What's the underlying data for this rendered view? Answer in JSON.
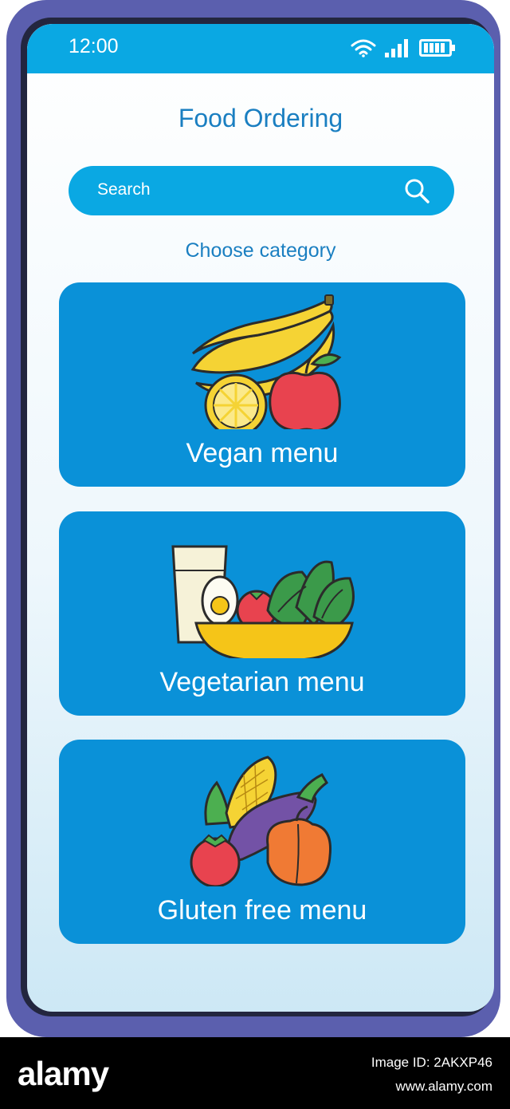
{
  "status_bar": {
    "time": "12:00",
    "icons": [
      "wifi-icon",
      "signal-icon",
      "battery-icon"
    ]
  },
  "app": {
    "title": "Food Ordering"
  },
  "search": {
    "placeholder": "Search",
    "icon": "search-icon"
  },
  "category_section": {
    "heading": "Choose category",
    "items": [
      {
        "label": "Vegan menu",
        "icon": "fruit-icon"
      },
      {
        "label": "Vegetarian menu",
        "icon": "salad-icon"
      },
      {
        "label": "Gluten free menu",
        "icon": "vegetables-icon"
      }
    ]
  },
  "footer": {
    "brand": "alamy",
    "image_id": "Image ID: 2AKXP46",
    "url": "www.alamy.com"
  },
  "colors": {
    "frame": "#5b5fae",
    "accent": "#0aa8e3",
    "card": "#0a91d8",
    "title_text": "#1a7fc1"
  }
}
